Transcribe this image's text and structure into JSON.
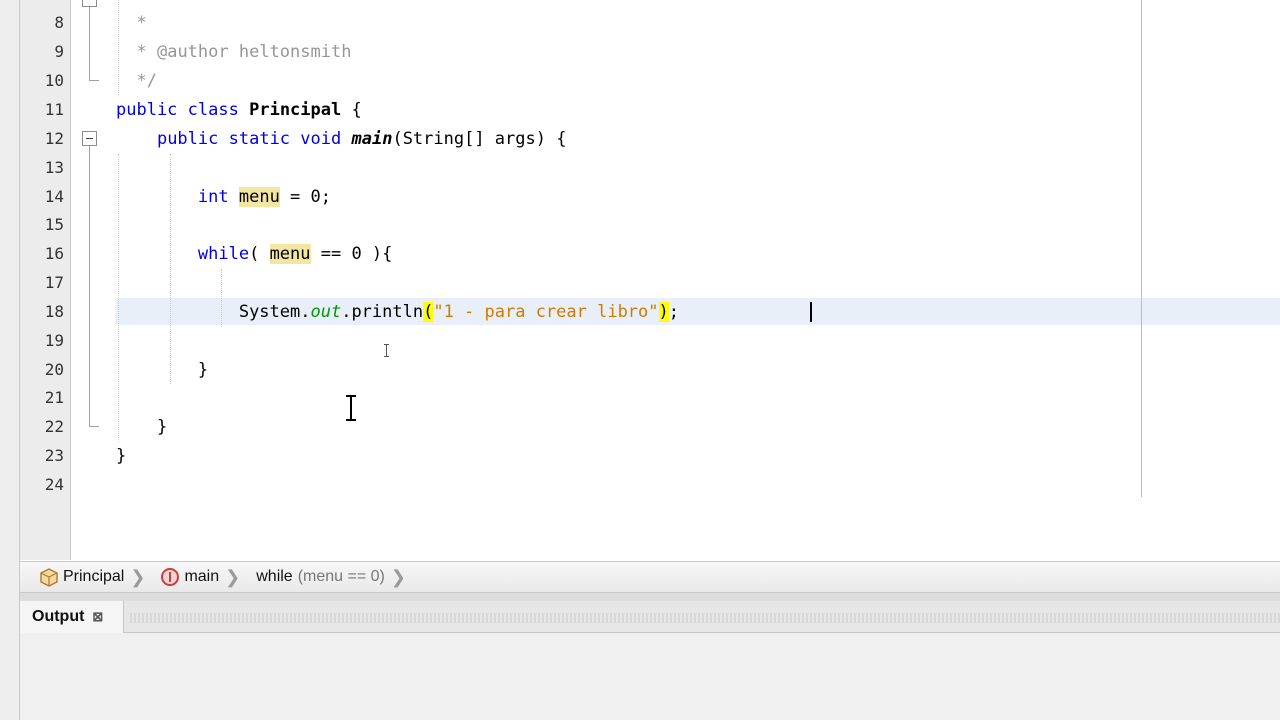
{
  "editor": {
    "lines": [
      {
        "num": "8",
        "text": "  *"
      },
      {
        "num": "9",
        "text": "  * @author heltonsmith"
      },
      {
        "num": "10",
        "text": "  */"
      },
      {
        "num": "11",
        "text": "public class Principal {"
      },
      {
        "num": "12",
        "text": "    public static void main(String[] args) {"
      },
      {
        "num": "13",
        "text": ""
      },
      {
        "num": "14",
        "text": "        int menu = 0;"
      },
      {
        "num": "15",
        "text": ""
      },
      {
        "num": "16",
        "text": "        while( menu == 0 ){"
      },
      {
        "num": "17",
        "text": ""
      },
      {
        "num": "18",
        "text": "            System.out.println(\"1 - para crear libro\");"
      },
      {
        "num": "19",
        "text": ""
      },
      {
        "num": "20",
        "text": "        }"
      },
      {
        "num": "21",
        "text": ""
      },
      {
        "num": "22",
        "text": "    }"
      },
      {
        "num": "23",
        "text": "}"
      },
      {
        "num": "24",
        "text": ""
      }
    ],
    "tokens": {
      "l8_star": "*",
      "l9_star": "* ",
      "l9_author": "@author heltonsmith",
      "l10_end": "*/",
      "kw_public": "public",
      "kw_class": "class",
      "class_name": "Principal",
      "brace_open": "{",
      "kw_static": "static",
      "kw_void": "void",
      "method_main": "main",
      "main_params": "(String[] args) ",
      "kw_int": "int",
      "var_menu": "menu",
      "assign_zero": " = 0;",
      "kw_while": "while",
      "while_open": "( ",
      "while_cond": " == 0 ){",
      "sys": "System.",
      "field_out": "out",
      "println": ".println",
      "paren_open": "(",
      "str_literal": "\"1 - para crear libro\"",
      "paren_close": ")",
      "semicolon": ";",
      "brace_close": "}"
    }
  },
  "breadcrumb": {
    "items": [
      {
        "label": "Principal",
        "icon": "class-icon"
      },
      {
        "label": "main",
        "icon": "method-icon"
      },
      {
        "label": "while",
        "detail": "(menu == 0)"
      }
    ]
  },
  "output": {
    "tab_label": "Output",
    "close_glyph": "⊠"
  },
  "colors": {
    "keyword": "#0000e6",
    "comment": "#969696",
    "string": "#ce7b00",
    "field": "#009900",
    "occurrence": "#f2e6a2",
    "brace_match": "#ffff00"
  }
}
